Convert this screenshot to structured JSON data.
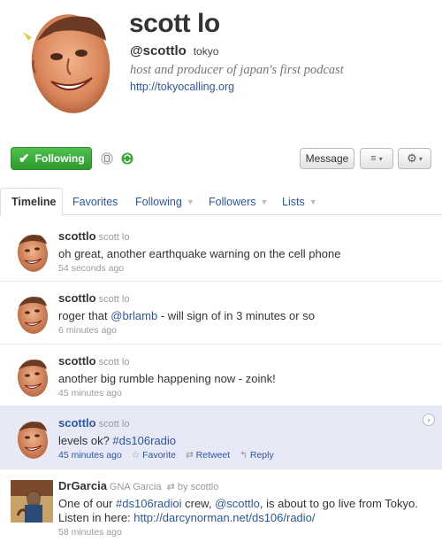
{
  "profile": {
    "name": "scott lo",
    "handle": "@scottlo",
    "location": "tokyo",
    "bio": "host and producer of japan's first podcast",
    "url": "http://tokyocalling.org"
  },
  "actions": {
    "following_label": "Following",
    "message_label": "Message",
    "list_icon": "list-icon",
    "gear_icon": "gear-icon",
    "following_color": "#37a837"
  },
  "tabs": [
    {
      "label": "Timeline",
      "active": true
    },
    {
      "label": "Favorites"
    },
    {
      "label": "Following"
    },
    {
      "label": "Followers"
    },
    {
      "label": "Lists"
    }
  ],
  "tweets": [
    {
      "user": "scottlo",
      "name": "scott lo",
      "text": "oh great, another earthquake warning on the cell phone",
      "time": "54 seconds ago"
    },
    {
      "user": "scottlo",
      "name": "scott lo",
      "text_pre": "roger that ",
      "mention": "@brlamb",
      "text_post": " - will sign of in 3 minutes or so",
      "time": "6 minutes ago"
    },
    {
      "user": "scottlo",
      "name": "scott lo",
      "text": "another big rumble happening now - zoink!",
      "time": "45 minutes ago"
    },
    {
      "user": "scottlo",
      "name": "scott lo",
      "text_pre": "levels ok? ",
      "hashtag": "#ds106radio",
      "time": "45 minutes ago",
      "favorite": "Favorite",
      "retweet": "Retweet",
      "reply": "Reply"
    },
    {
      "user": "DrGarcia",
      "name": "GNA Garcia",
      "retweeted_by": "by scottlo",
      "text_pre": "One of our ",
      "hashtag": "#ds106radioi",
      "text_mid": " crew, ",
      "mention": "@scottlo",
      "text_mid2": ", is about to go live from Tokyo. Listen in here: ",
      "link": "http://darcynorman.net/ds106/radio/",
      "time": "58 minutes ago"
    }
  ]
}
